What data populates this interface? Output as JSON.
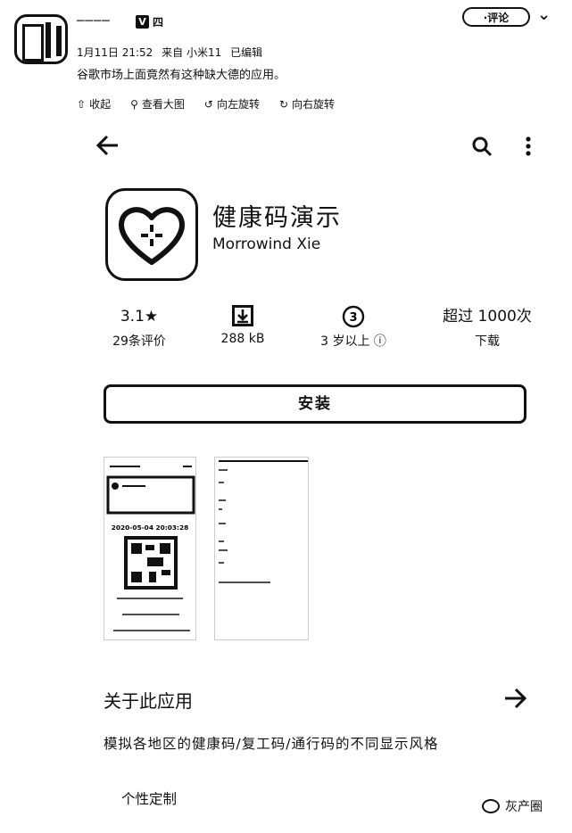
{
  "post": {
    "username": "────",
    "verified_badge": "V",
    "level": "四",
    "follow_label": "·评论",
    "meta": {
      "date": "1月11日 21:52",
      "source": "来自 小米11",
      "status": "已编辑"
    },
    "text": "谷歌市场上面竟然有这种缺大德的应用。",
    "actions": [
      {
        "label": "收起",
        "icon": "collapse-icon"
      },
      {
        "label": "查看大图",
        "icon": "search-icon"
      },
      {
        "label": "向左旋转",
        "icon": "rotate-left-icon"
      },
      {
        "label": "向右旋转",
        "icon": "rotate-right-icon"
      }
    ]
  },
  "app": {
    "name": "健康码演示",
    "developer": "Morrowind Xie",
    "icon": "heart-crosshair-icon",
    "stats": {
      "rating": "3.1★",
      "reviews": "29条评价",
      "size": "288 kB",
      "age_badge": "3",
      "age": "3 岁以上",
      "downloads": "超过 1000次",
      "downloads_label": "下载"
    },
    "install_label": "安装",
    "screenshot_timestamp": "2020-05-04 20:03:28",
    "about_title": "关于此应用",
    "description": "模拟各地区的健康码/复工码/通行码的不同显示风格",
    "chip": "个性定制"
  },
  "watermark": "灰产圈"
}
